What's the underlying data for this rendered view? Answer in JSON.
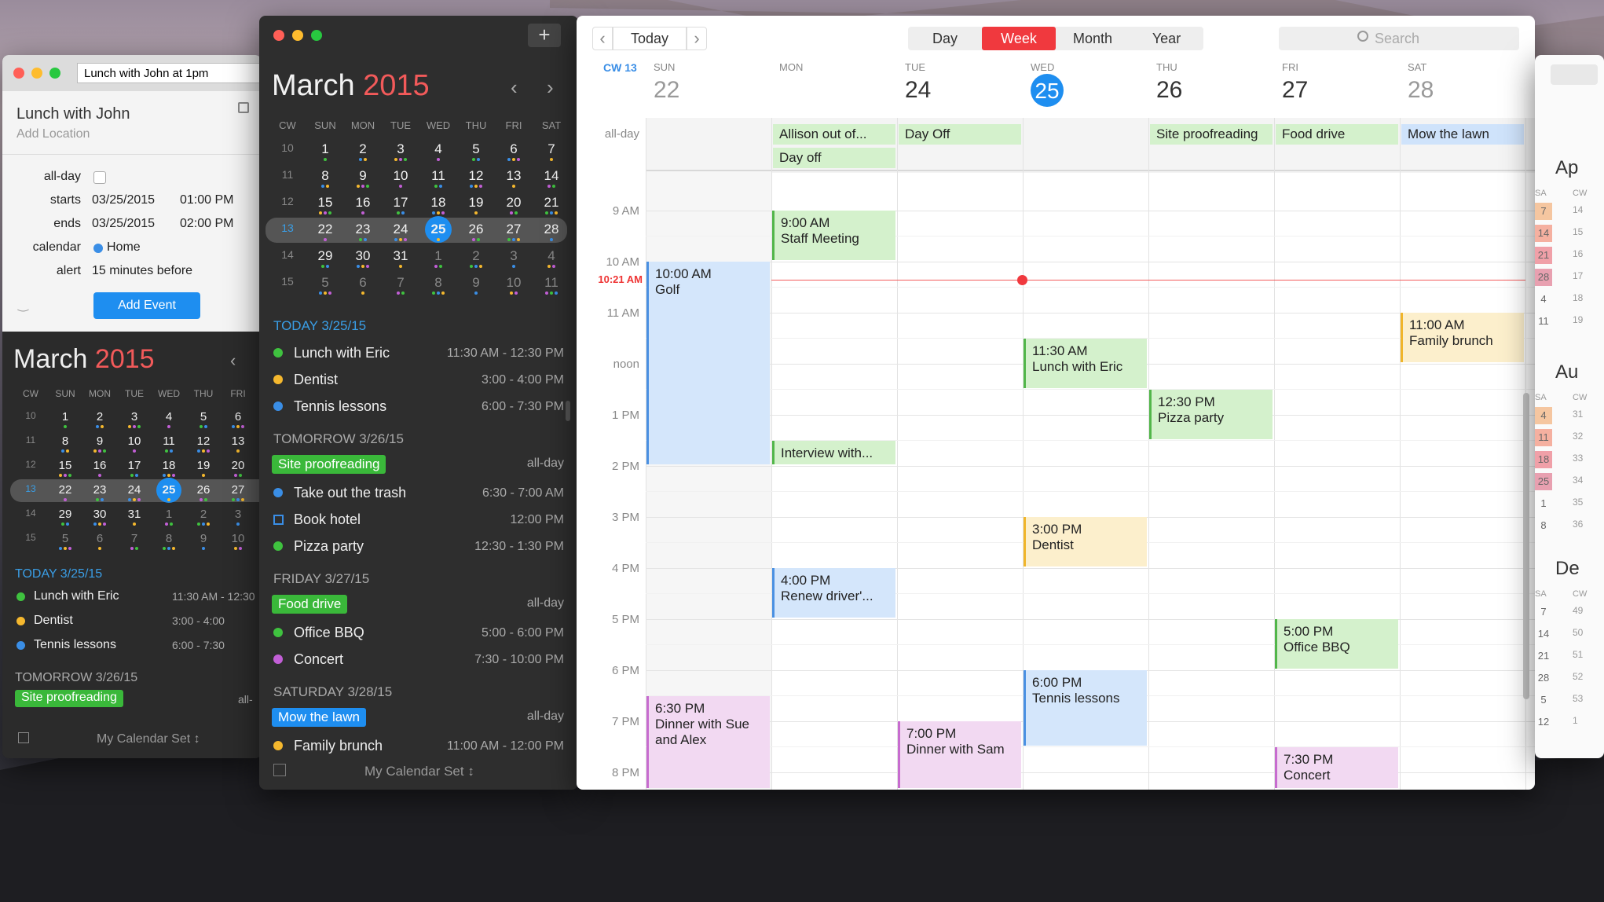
{
  "popover": {
    "title_field": "Lunch with John at 1pm",
    "event_title": "Lunch with John",
    "add_location": "Add Location",
    "allday_label": "all-day",
    "starts_label": "starts",
    "starts_date": "03/25/2015",
    "starts_time": "01:00 PM",
    "ends_label": "ends",
    "ends_date": "03/25/2015",
    "ends_time": "02:00 PM",
    "calendar_label": "calendar",
    "calendar_value": "Home",
    "alert_label": "alert",
    "alert_value": "15 minutes before",
    "add_button": "Add Event"
  },
  "mini": {
    "month": "March",
    "year": "2015",
    "headers": [
      "CW",
      "SUN",
      "MON",
      "TUE",
      "WED",
      "THU",
      "FRI",
      "SAT"
    ],
    "weeks": [
      {
        "cw": "10",
        "days": [
          "1",
          "2",
          "3",
          "4",
          "5",
          "6",
          "7"
        ]
      },
      {
        "cw": "11",
        "days": [
          "8",
          "9",
          "10",
          "11",
          "12",
          "13",
          "14"
        ]
      },
      {
        "cw": "12",
        "days": [
          "15",
          "16",
          "17",
          "18",
          "19",
          "20",
          "21"
        ]
      },
      {
        "cw": "13",
        "days": [
          "22",
          "23",
          "24",
          "25",
          "26",
          "27",
          "28"
        ]
      },
      {
        "cw": "14",
        "days": [
          "29",
          "30",
          "31",
          "1",
          "2",
          "3",
          "4"
        ]
      },
      {
        "cw": "15",
        "days": [
          "5",
          "6",
          "7",
          "8",
          "9",
          "10",
          "11"
        ]
      }
    ],
    "today_header": "TODAY 3/25/15",
    "tomorrow_header": "TOMORROW 3/26/15",
    "friday_header": "FRIDAY 3/27/15",
    "saturday_header": "SATURDAY 3/28/15",
    "allday": "all-day",
    "today": [
      {
        "name": "Lunch with Eric",
        "time": "11:30 AM - 12:30 PM",
        "color": "#3fc23f"
      },
      {
        "name": "Dentist",
        "time": "3:00 - 4:00 PM",
        "color": "#f5b82e"
      },
      {
        "name": "Tennis lessons",
        "time": "6:00 - 7:30 PM",
        "color": "#3a8ee6"
      }
    ],
    "tomorrow_tag": "Site proofreading",
    "tomorrow": [
      {
        "name": "Take out the trash",
        "time": "6:30 - 7:00 AM",
        "color": "#3a8ee6"
      },
      {
        "name": "Book hotel",
        "time": "12:00 PM",
        "color": "box"
      },
      {
        "name": "Pizza party",
        "time": "12:30 - 1:30 PM",
        "color": "#3fc23f"
      }
    ],
    "friday_tag": "Food drive",
    "friday": [
      {
        "name": "Office BBQ",
        "time": "5:00 - 6:00 PM",
        "color": "#3fc23f"
      },
      {
        "name": "Concert",
        "time": "7:30 - 10:00 PM",
        "color": "#c25fd6"
      }
    ],
    "saturday_tag": "Mow the lawn",
    "saturday": [
      {
        "name": "Family brunch",
        "time": "11:00 AM - 12:00 PM",
        "color": "#f5b82e"
      }
    ],
    "calendar_set": "My Calendar Set ↕",
    "small_today": [
      {
        "name": "Lunch with Eric",
        "time": "11:30 AM - 12:30"
      },
      {
        "name": "Dentist",
        "time": "3:00 - 4:00"
      },
      {
        "name": "Tennis lessons",
        "time": "6:00 - 7:30"
      }
    ],
    "small_allday": "all-"
  },
  "toolbar": {
    "today": "Today",
    "views": [
      "Day",
      "Week",
      "Month",
      "Year"
    ],
    "active": "Week",
    "search_placeholder": "Search"
  },
  "week": {
    "cw": "CW 13",
    "days": [
      {
        "dow": "SUN",
        "date": "22"
      },
      {
        "dow": "MON",
        "date": ""
      },
      {
        "dow": "TUE",
        "date": "24"
      },
      {
        "dow": "WED",
        "date": "25"
      },
      {
        "dow": "THU",
        "date": "26"
      },
      {
        "dow": "FRI",
        "date": "27"
      },
      {
        "dow": "SAT",
        "date": "28"
      }
    ],
    "allday_label": "all-day",
    "allday_events": [
      {
        "day": 1,
        "row": 0,
        "title": "Allison out of..."
      },
      {
        "day": 1,
        "row": 1,
        "title": "Day off"
      },
      {
        "day": 2,
        "row": 0,
        "title": "Day Off"
      },
      {
        "day": 4,
        "row": 0,
        "title": "Site proofreading"
      },
      {
        "day": 5,
        "row": 0,
        "title": "Food drive"
      },
      {
        "day": 6,
        "row": 0,
        "title": "Mow the lawn",
        "blue": true
      }
    ],
    "hours": [
      "9 AM",
      "10 AM",
      "11 AM",
      "noon",
      "1 PM",
      "2 PM",
      "3 PM",
      "4 PM",
      "5 PM",
      "6 PM",
      "7 PM",
      "8 PM"
    ],
    "now_label": "10:21 AM",
    "events": [
      {
        "day": 0,
        "start": 10,
        "end": 14,
        "time": "10:00 AM",
        "title": "Golf",
        "kind": "blue"
      },
      {
        "day": 1,
        "start": 9,
        "end": 10,
        "time": "9:00 AM",
        "title": "Staff Meeting",
        "kind": "green"
      },
      {
        "day": 1,
        "start": 13.5,
        "end": 14,
        "time": "",
        "title": "Interview with...",
        "kind": "green"
      },
      {
        "day": 1,
        "start": 16,
        "end": 17,
        "time": "4:00 PM",
        "title": "Renew driver'...",
        "kind": "blue"
      },
      {
        "day": 3,
        "start": 11.5,
        "end": 12.5,
        "time": "11:30 AM",
        "title": "Lunch with Eric",
        "kind": "green"
      },
      {
        "day": 3,
        "start": 15,
        "end": 16,
        "time": "3:00 PM",
        "title": "Dentist",
        "kind": "yellow"
      },
      {
        "day": 3,
        "start": 18,
        "end": 19.5,
        "time": "6:00 PM",
        "title": "Tennis lessons",
        "kind": "blue"
      },
      {
        "day": 4,
        "start": 12.5,
        "end": 13.5,
        "time": "12:30 PM",
        "title": "Pizza party",
        "kind": "green"
      },
      {
        "day": 5,
        "start": 17,
        "end": 18,
        "time": "5:00 PM",
        "title": "Office BBQ",
        "kind": "green"
      },
      {
        "day": 5,
        "start": 19.5,
        "end": 21,
        "time": "7:30 PM",
        "title": "Concert",
        "kind": "purple"
      },
      {
        "day": 6,
        "start": 11,
        "end": 12,
        "time": "11:00 AM",
        "title": "Family brunch",
        "kind": "yellow"
      },
      {
        "day": 0,
        "start": 18.5,
        "end": 20.5,
        "time": "6:30 PM",
        "title": "Dinner with Sue and Alex",
        "kind": "purple"
      },
      {
        "day": 2,
        "start": 19,
        "end": 20.5,
        "time": "7:00 PM",
        "title": "Dinner with Sam",
        "kind": "purple"
      }
    ]
  },
  "right_months": [
    "Ap",
    "Au",
    "De"
  ],
  "right_cols": {
    "sa": "SA",
    "cw": "CW"
  },
  "right_nums_1": [
    [
      "7",
      "14"
    ],
    [
      "14",
      "15"
    ],
    [
      "21",
      "16"
    ],
    [
      "28",
      "17"
    ],
    [
      "4",
      "18"
    ],
    [
      "11",
      "19"
    ]
  ],
  "right_nums_2": [
    [
      "4",
      "31"
    ],
    [
      "11",
      "32"
    ],
    [
      "18",
      "33"
    ],
    [
      "25",
      "34"
    ],
    [
      "1",
      "35"
    ],
    [
      "8",
      "36"
    ]
  ],
  "right_nums_3": [
    [
      "7",
      "49"
    ],
    [
      "14",
      "50"
    ],
    [
      "21",
      "51"
    ],
    [
      "28",
      "52"
    ],
    [
      "5",
      "53"
    ],
    [
      "12",
      "1"
    ]
  ]
}
